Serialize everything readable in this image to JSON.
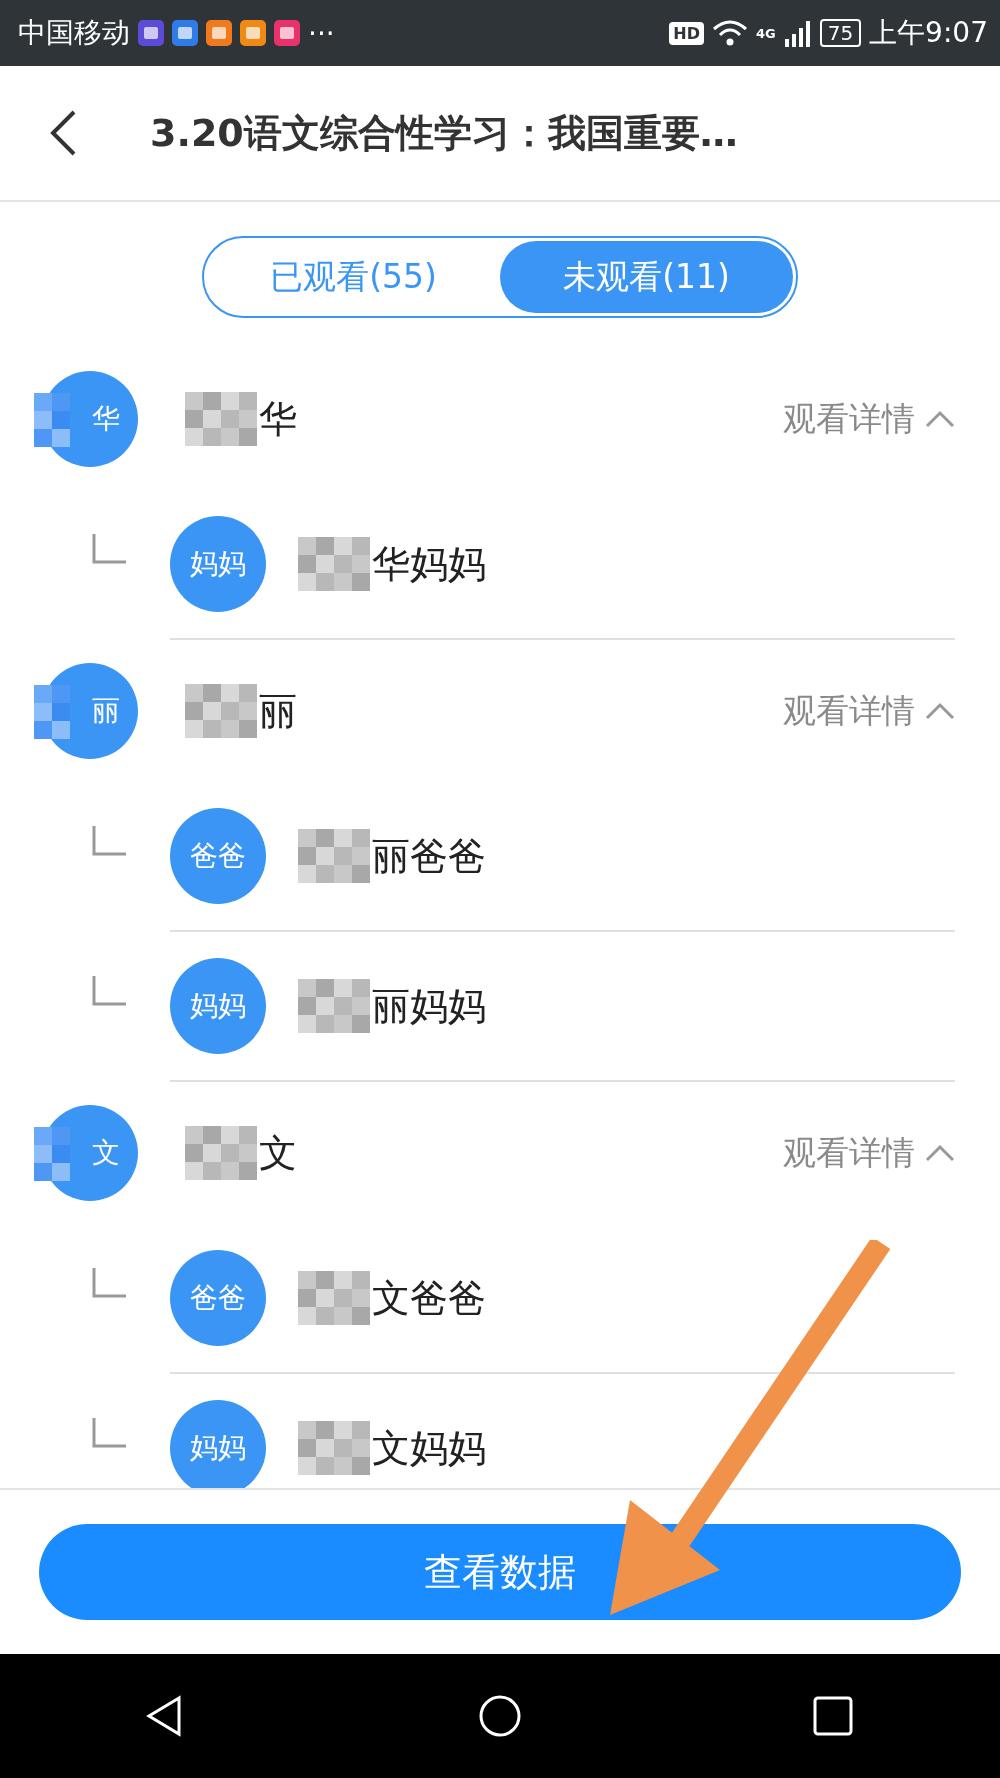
{
  "status_bar": {
    "carrier": "中国移动",
    "more": "···",
    "hd": "HD",
    "network": "4G",
    "battery": "75",
    "time": "上午9:07"
  },
  "header": {
    "title": "3.20语文综合性学习：我国重要…"
  },
  "tabs": [
    {
      "label": "已观看(55)",
      "selected": false
    },
    {
      "label": "未观看(11)",
      "selected": true
    }
  ],
  "students": [
    {
      "avatar": "华",
      "name": "华",
      "action": "观看详情",
      "expanded": true,
      "children": [
        {
          "avatar": "妈妈",
          "name": "华妈妈"
        }
      ]
    },
    {
      "avatar": "丽",
      "name": "丽",
      "action": "观看详情",
      "expanded": true,
      "children": [
        {
          "avatar": "爸爸",
          "name": "丽爸爸"
        },
        {
          "avatar": "妈妈",
          "name": "丽妈妈"
        }
      ]
    },
    {
      "avatar": "文",
      "name": "文",
      "action": "观看详情",
      "expanded": true,
      "children": [
        {
          "avatar": "爸爸",
          "name": "文爸爸"
        },
        {
          "avatar": "妈妈",
          "name": "文妈妈"
        }
      ]
    }
  ],
  "footer": {
    "button": "查看数据"
  }
}
